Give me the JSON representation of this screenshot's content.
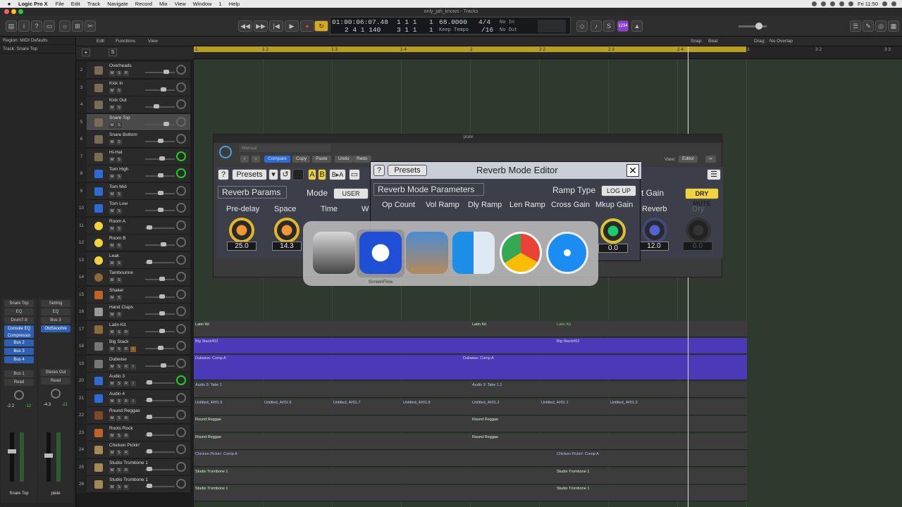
{
  "menubar": {
    "apple": "",
    "app": "Logic Pro X",
    "items": [
      "File",
      "Edit",
      "Track",
      "Navigate",
      "Record",
      "Mix",
      "View",
      "Window",
      "1",
      "Help"
    ],
    "clock": "Fri 11:50"
  },
  "window": {
    "title": "only_jah_knows - Tracks"
  },
  "lcd": {
    "position": "01:00:06:07.48",
    "bars": "2 4 1 140",
    "pos2a": "1 1 1",
    "pos2b": "3 1 1",
    "one_a": "1",
    "one_b": "1",
    "tempo": "68.0000",
    "tempo_label": "Keep Tempo",
    "sig": "4/4",
    "div": "/16",
    "in": "No In",
    "out": "No Out"
  },
  "inspector": {
    "region": "Region: MIDI Defaults",
    "track": "Track: Snare Top"
  },
  "strips": [
    {
      "name": "Snare Top",
      "setting": "EQ",
      "input": "Drum7-8",
      "slot": "Console EQ Compressor",
      "sends": [
        "Bus 2",
        "Bus 3",
        "Bus 4"
      ],
      "output": "Bus 1",
      "auto": "Read",
      "vol": "-2.2",
      "peak": "-12",
      "bottom": "Snare Top"
    },
    {
      "name": "Setting",
      "setting": "EQ",
      "input": "Bus 3",
      "slot": "OldSkoolVe",
      "sends": [],
      "output": "Stereo Out",
      "auto": "Read",
      "vol": "-4.3",
      "peak": "-21",
      "bottom": "plate"
    }
  ],
  "tlhead": {
    "edit": "Edit",
    "functions": "Functions",
    "view": "View",
    "snap_label": "Snap:",
    "snap": "Beat",
    "drag_label": "Drag:",
    "drag": "No Overlap"
  },
  "ruler": {
    "marks": [
      "1",
      "1 2",
      "1 3",
      "1 4",
      "2",
      "2 2",
      "2 3",
      "2 4",
      "3",
      "3 2",
      "3 3"
    ]
  },
  "tracks": [
    {
      "n": "2",
      "name": "Overheads",
      "btns": [
        "M",
        "S",
        "R"
      ]
    },
    {
      "n": "3",
      "name": "Kick In",
      "btns": [
        "M",
        "S"
      ]
    },
    {
      "n": "4",
      "name": "Kick Out",
      "btns": [
        "M",
        "S"
      ]
    },
    {
      "n": "5",
      "name": "Snare Top",
      "btns": [
        "M",
        "S"
      ]
    },
    {
      "n": "6",
      "name": "Snare Bottom",
      "btns": [
        "M",
        "S"
      ]
    },
    {
      "n": "7",
      "name": "Hi-Hat",
      "btns": [
        "M",
        "S"
      ]
    },
    {
      "n": "8",
      "name": "Tom High",
      "btns": [
        "M",
        "S"
      ]
    },
    {
      "n": "9",
      "name": "Tom Mid",
      "btns": [
        "M",
        "S"
      ]
    },
    {
      "n": "10",
      "name": "Tom Low",
      "btns": [
        "M",
        "S"
      ]
    },
    {
      "n": "11",
      "name": "Room A",
      "btns": [
        "M",
        "S"
      ]
    },
    {
      "n": "12",
      "name": "Room B",
      "btns": [
        "M",
        "S"
      ]
    },
    {
      "n": "13",
      "name": "Leak",
      "btns": [
        "M",
        "S"
      ]
    },
    {
      "n": "14",
      "name": "Tambourine",
      "btns": [
        "M",
        "S"
      ]
    },
    {
      "n": "15",
      "name": "Shaker",
      "btns": [
        "M",
        "S"
      ]
    },
    {
      "n": "16",
      "name": "Hand Claps",
      "btns": [
        "M",
        "S"
      ]
    },
    {
      "n": "17",
      "name": "Latin Kit",
      "btns": [
        "M",
        "S",
        "R"
      ]
    },
    {
      "n": "18",
      "name": "Big Stack",
      "btns": [
        "M",
        "S",
        "R",
        "I"
      ]
    },
    {
      "n": "19",
      "name": "Dubwise",
      "btns": [
        "M",
        "S",
        "R",
        "I"
      ]
    },
    {
      "n": "20",
      "name": "Audio 3",
      "btns": [
        "M",
        "S",
        "R",
        "I"
      ]
    },
    {
      "n": "21",
      "name": "Audio 4",
      "btns": [
        "M",
        "S",
        "R",
        "I"
      ]
    },
    {
      "n": "22",
      "name": "Round Reggae",
      "btns": [
        "M",
        "S",
        "R"
      ]
    },
    {
      "n": "23",
      "name": "Roots Rock",
      "btns": [
        "M",
        "S",
        "R"
      ]
    },
    {
      "n": "24",
      "name": "Chicken Pickin'",
      "btns": [
        "M",
        "S",
        "R"
      ]
    },
    {
      "n": "25",
      "name": "Studio Trombone 1",
      "btns": [
        "M",
        "S",
        "R"
      ]
    },
    {
      "n": "26",
      "name": "Studio Trombone 1",
      "btns": [
        "M",
        "S",
        "R"
      ]
    }
  ],
  "regions": {
    "latin": [
      "Latin Kit",
      "Latin Kit",
      "Latin Kit"
    ],
    "bigstack": [
      "Big Stack#02",
      "Big Stack#02"
    ],
    "dubwise": [
      "Dubwise: Comp A",
      "Dubwise: Comp A"
    ],
    "audio3": [
      "Audio 3: Take 1",
      "Audio 3: Take 1.1"
    ],
    "audio4": [
      "Untitled_4#01.5",
      "Untitled_4#01.6",
      "Untitled_4#01.7",
      "Untitled_4#01.8",
      "Untitled_4#01.2",
      "Untitled_4#01.1",
      "Untitled_4#01.3"
    ],
    "reggae": [
      "Round Reggae",
      "Round Reggae"
    ],
    "roots": [
      "Round Reggae",
      "Round Reggae"
    ],
    "chicken": [
      "Chicken Pickin': Comp A",
      "Chicken Pickin': Comp A"
    ],
    "trombone1": [
      "Studio Trombone 1",
      "Studio Trombone 1"
    ],
    "trombone2": [
      "Studio Trombone 1",
      "Studio Trombone 1"
    ]
  },
  "plugin": {
    "title": "plate",
    "preset": "Manual",
    "compare": "Compare",
    "copy": "Copy",
    "paste": "Paste",
    "undo": "Undo",
    "redo": "Redo",
    "view_label": "View:",
    "view": "Editor",
    "help": "?",
    "presets": "Presets",
    "ab_a": "A",
    "ab_b": "B",
    "ab_copy": "B▸A",
    "params_tab": "Reverb Params",
    "mode_label": "Mode",
    "mode": "USER",
    "dry_mute": "DRY MUTE",
    "out_gain": "t Gain",
    "reverb": "Reverb",
    "dry": "Dry",
    "knobs": [
      {
        "label": "Pre-delay",
        "value": "25.0"
      },
      {
        "label": "Space",
        "value": "14.3"
      },
      {
        "label": "Time",
        "value": ""
      },
      {
        "label": "W",
        "value": ""
      }
    ],
    "reverb_value": "12.0",
    "dry_value": "0.0"
  },
  "rme": {
    "title": "Reverb Mode Editor",
    "help": "?",
    "presets": "Presets",
    "params": "Reverb Mode Parameters",
    "ramp_type_label": "Ramp Type",
    "ramp_type": "LOG UP",
    "cols": [
      "Op Count",
      "Vol Ramp",
      "Dly Ramp",
      "Len Ramp",
      "Cross Gain",
      "Mkup Gain"
    ],
    "mkup_value": "0.0"
  },
  "switcher": {
    "selected": "ScreenFlow",
    "apps": [
      "logic-pro-icon",
      "screenflow-icon",
      "preview-icon",
      "finder-icon",
      "chrome-icon",
      "safari-icon"
    ]
  }
}
